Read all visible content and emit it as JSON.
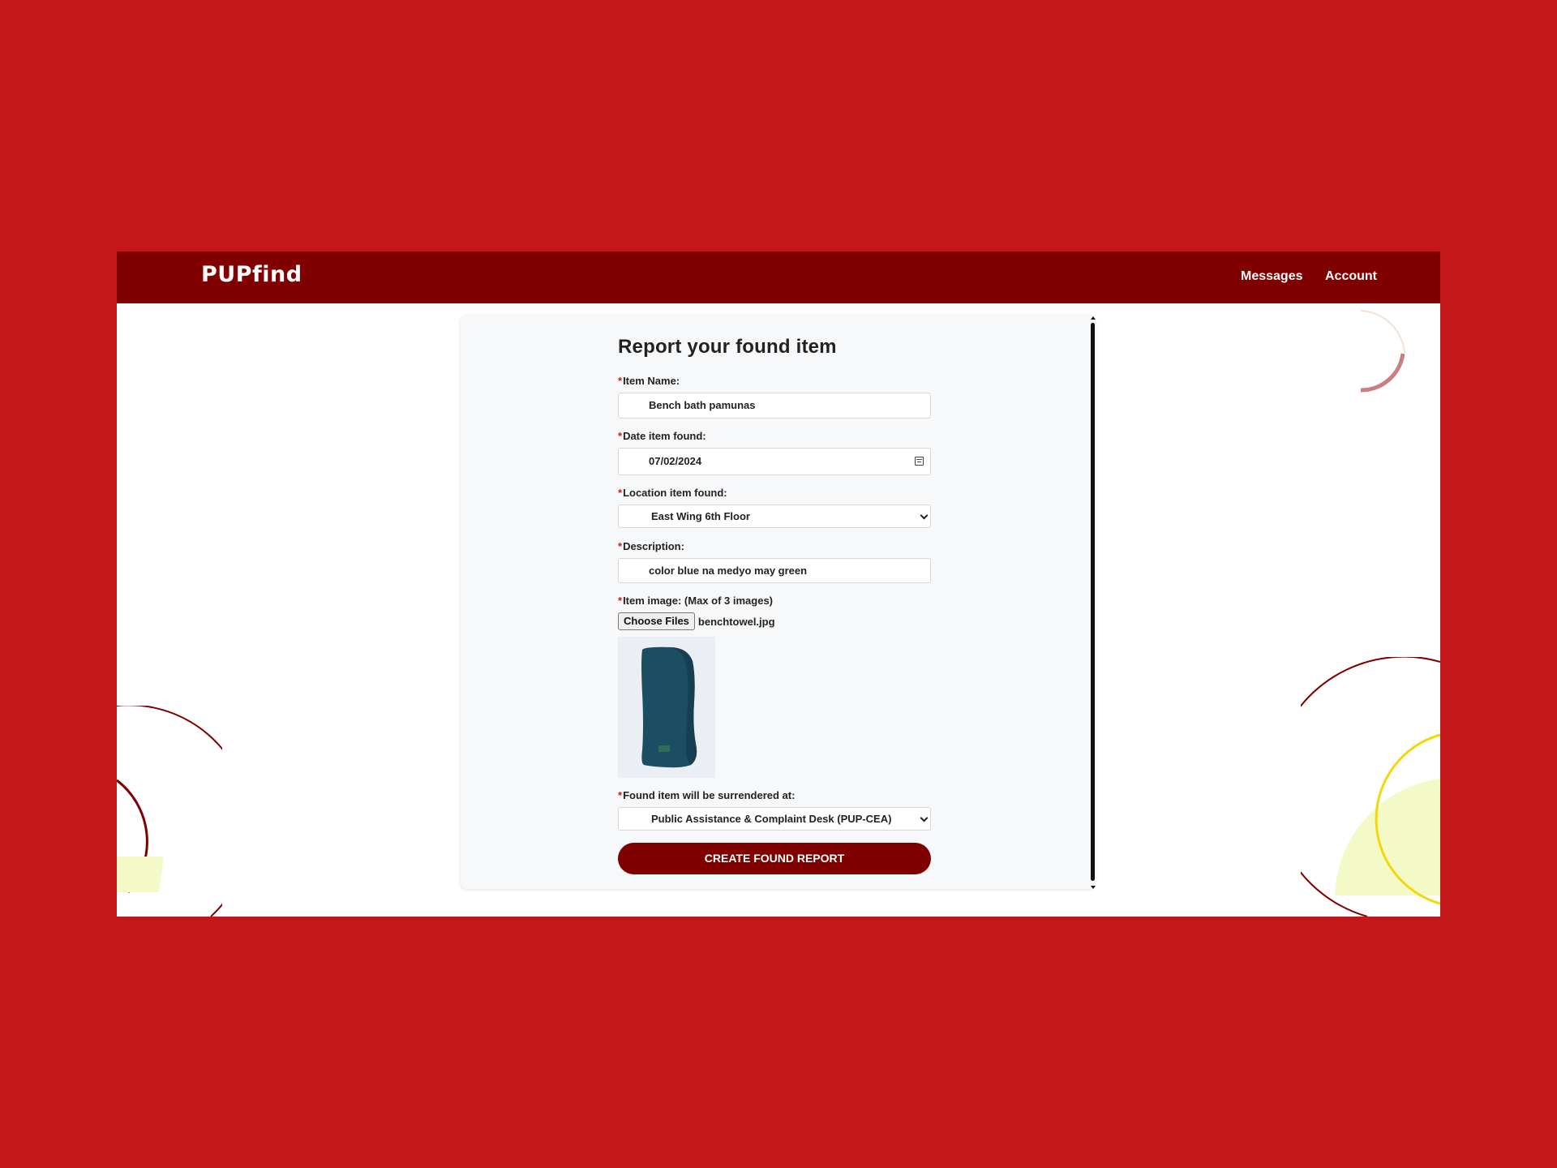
{
  "app": {
    "logo": "PUPfind"
  },
  "nav": {
    "messages": "Messages",
    "account": "Account"
  },
  "form": {
    "title": "Report your found item",
    "required_mark": "*",
    "item_name": {
      "label": "Item Name:",
      "value": "Bench bath pamunas"
    },
    "date_found": {
      "label": "Date item found:",
      "value": "07/02/2024"
    },
    "location_found": {
      "label": "Location item found:",
      "value": "East Wing 6th Floor"
    },
    "description": {
      "label": "Description:",
      "value": "color blue na medyo may green"
    },
    "item_image": {
      "label": "Item image: (Max of 3 images)",
      "button": "Choose Files",
      "file_name": "benchtowel.jpg"
    },
    "surrender_at": {
      "label": "Found item will be surrendered at:",
      "value": "Public Assistance & Complaint Desk (PUP-CEA)"
    },
    "submit": "CREATE FOUND REPORT"
  },
  "colors": {
    "page_bg": "#c41718",
    "nav_bg": "#800000",
    "accent": "#800000",
    "required": "#dd1111",
    "towel": "#1b4e63"
  }
}
